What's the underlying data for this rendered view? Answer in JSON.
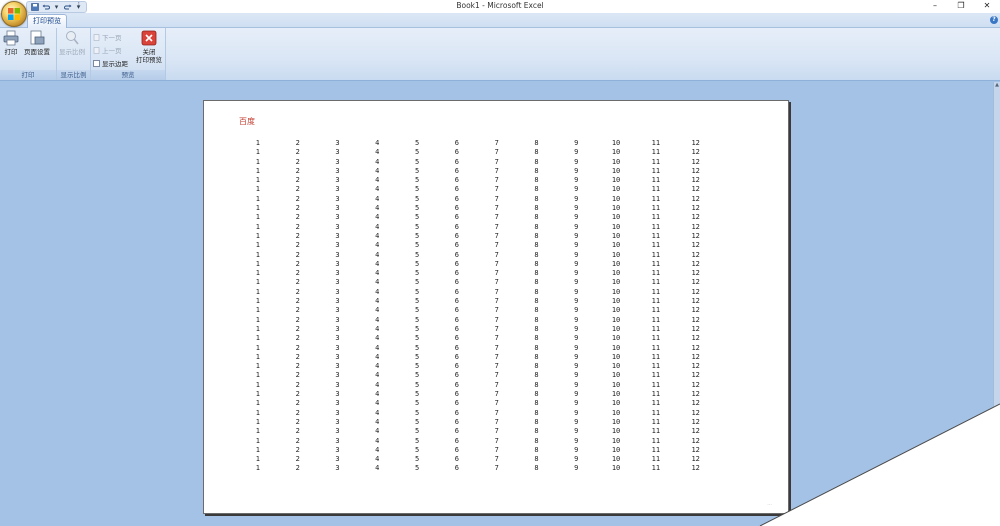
{
  "window": {
    "title": "Book1 - Microsoft Excel",
    "controls": [
      "–",
      "❐",
      "✕"
    ]
  },
  "qat": {
    "more": "⇣"
  },
  "tabs": {
    "active_label": "打印预览",
    "help": "?"
  },
  "ribbon": {
    "groups": [
      {
        "label": "打印"
      },
      {
        "label": "显示比例"
      },
      {
        "label": "预览"
      }
    ],
    "print_label": "打印",
    "page_setup_label": "页面设置",
    "zoom_label": "显示比例",
    "next_page_label": "下一页",
    "prev_page_label": "上一页",
    "show_margins_label": "显示边距",
    "close_label_1": "关闭",
    "close_label_2": "打印预览"
  },
  "page": {
    "header": "百度",
    "footer": "...",
    "row_count": 36,
    "row_values": [
      1,
      2,
      3,
      4,
      5,
      6,
      7,
      8,
      9,
      10,
      11,
      12
    ]
  },
  "colors": {
    "accent": "#15428b",
    "header_text": "#c0392b",
    "background": "#a4c2e6"
  }
}
